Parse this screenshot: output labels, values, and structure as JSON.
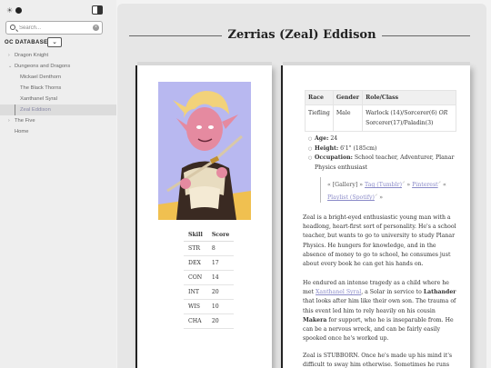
{
  "sidebar": {
    "search_placeholder": "Search...",
    "db_title": "OC DATABASE",
    "collapse_glyph": "⌄",
    "items": [
      {
        "label": "Dragon Knight",
        "type": "folder"
      },
      {
        "label": "Dungeons and Dragons",
        "type": "folder-open"
      },
      {
        "label": "Mickael Denthorn",
        "type": "child"
      },
      {
        "label": "The Black Thorns",
        "type": "child"
      },
      {
        "label": "Xanthanel Syral",
        "type": "child"
      },
      {
        "label": "Zeal Eddison",
        "type": "child-active"
      },
      {
        "label": "The Five",
        "type": "folder"
      },
      {
        "label": "Home",
        "type": "link"
      }
    ]
  },
  "page": {
    "title": "Zerrias (Zeal) Eddison"
  },
  "stats": {
    "headers": [
      "Skill",
      "Score"
    ],
    "rows": [
      [
        "STR",
        "8"
      ],
      [
        "DEX",
        "17"
      ],
      [
        "CON",
        "14"
      ],
      [
        "INT",
        "20"
      ],
      [
        "WIS",
        "10"
      ],
      [
        "CHA",
        "20"
      ]
    ]
  },
  "info": {
    "headers": [
      "Race",
      "Gender",
      "Role/Class"
    ],
    "race": "Tiefling",
    "gender": "Male",
    "class_pre": "Warlock (14)/Sorcerer(6) ",
    "class_or": "OR",
    "class_post": "Sorcerer(17)/Paladin(3)"
  },
  "details": {
    "age_label": "Age:",
    "age": "24",
    "height_label": "Height:",
    "height": "6'1\" (185cm)",
    "occupation_label": "Occupation:",
    "occupation": "School teacher, Adventurer, Planar Physics enthusiast"
  },
  "links": {
    "gallery": "« [Gallery] »",
    "tumblr": "Tag (Tumblr)",
    "pinterest": "Pinterest",
    "spotify": "Playlist (Spotify)",
    "sep": "»",
    "sep2": "«"
  },
  "bio": {
    "p1": "Zeal is a bright-eyed enthusiastic young man with a headlong, heart-first sort of personality. He's a school teacher, but wants to go to university to study Planar Physics. He hungers for knowledge, and in the absence of money to go to school, he consumes just about every book he can get his hands on.",
    "p2_a": "He endured an intense tragedy as a child where he met ",
    "p2_link": "Xanthanel Syral",
    "p2_b": ", a Solar in service to ",
    "p2_bold1": "Lathander",
    "p2_c": " that looks after him like their own son. The trauma of this event led him to rely heavily on his cousin ",
    "p2_bold2": "Makera",
    "p2_d": " for support, who he is inseparable from. He can be a nervous wreck, and can be fairly easily spooked once he's worked up.",
    "p3": "Zeal is STUBBORN. Once he's made up his mind it's difficult to sway him otherwise. Sometimes he runs"
  },
  "icons": {
    "sun": "☀",
    "clear": "×"
  },
  "colors": {
    "accent_link": "#8a8ac8",
    "portrait_bg": "#b8b8f0"
  }
}
